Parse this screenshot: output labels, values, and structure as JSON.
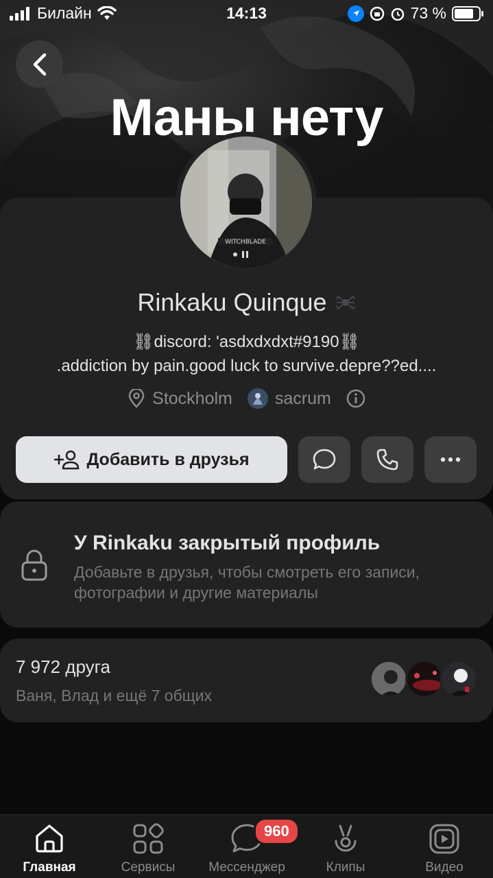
{
  "status_bar": {
    "carrier": "Билайн",
    "time": "14:13",
    "battery": "73 %"
  },
  "cover": {
    "title": "Маны нету"
  },
  "profile": {
    "name": "Rinkaku Quinque",
    "status_line_1": "⛓discord: 'asdxdxdxt#9190⛓",
    "status_line_2": ".addiction by pain.good luck to survive.depre??ed....",
    "location": "Stockholm",
    "community": "sacrum",
    "avatar_caption": "WITCHBLADE"
  },
  "actions": {
    "add_friend": "Добавить в друзья",
    "message_icon": "message-icon",
    "call_icon": "phone-icon",
    "more_icon": "more-icon"
  },
  "closed_profile": {
    "title": "У Rinkaku закрытый профиль",
    "description": "Добавьте в друзья, чтобы смотреть его записи, фотографии и другие материалы"
  },
  "friends": {
    "count": "7 972 друга",
    "mutual": "Ваня, Влад и ещё 7 общих"
  },
  "tabbar": {
    "tabs": [
      {
        "label": "Главная",
        "icon": "home-icon",
        "active": true
      },
      {
        "label": "Сервисы",
        "icon": "services-icon",
        "active": false
      },
      {
        "label": "Мессенджер",
        "icon": "messenger-icon",
        "active": false
      },
      {
        "label": "Клипы",
        "icon": "clips-icon",
        "active": false
      },
      {
        "label": "Видео",
        "icon": "video-icon",
        "active": false
      }
    ],
    "messenger_badge": "960"
  },
  "colors": {
    "background": "#0a0a0a",
    "card": "#222222",
    "primary_button": "#e1e3e6",
    "secondary_button": "#3d3d3d",
    "badge": "#e64646",
    "muted_text": "#767676"
  }
}
